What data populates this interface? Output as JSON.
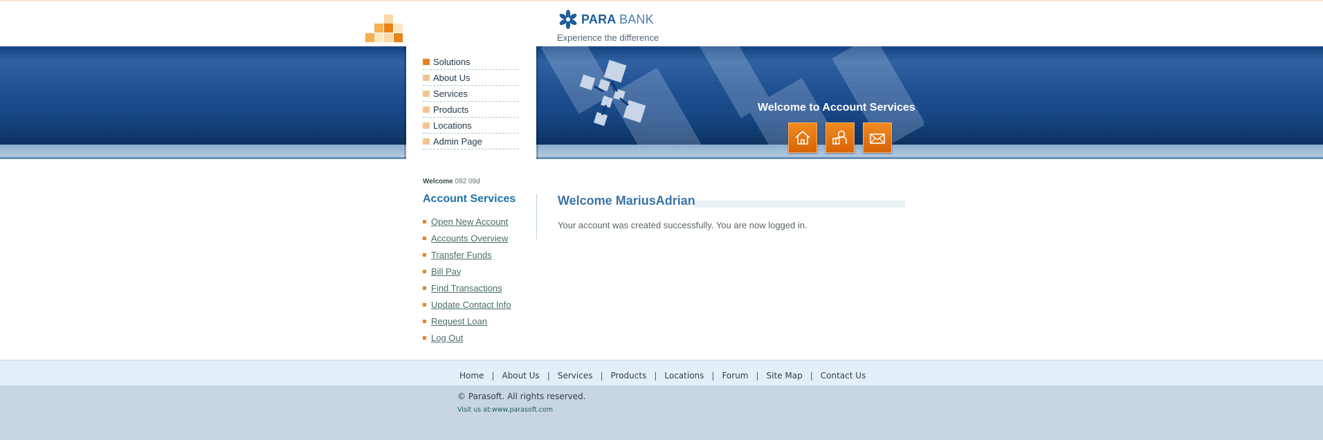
{
  "brand": {
    "name_bold": "PARA",
    "name_light": "BANK",
    "tagline": "Experience the difference"
  },
  "topnav": {
    "items": [
      "Solutions",
      "About Us",
      "Services",
      "Products",
      "Locations",
      "Admin Page"
    ]
  },
  "banner": {
    "welcome": "Welcome to Account Services",
    "icons": [
      "home-icon",
      "contact-icon",
      "mail-icon"
    ]
  },
  "sidebar": {
    "welcome_label": "Welcome",
    "welcome_user": "092 09d",
    "title": "Account Services",
    "links": [
      "Open New Account",
      "Accounts Overview",
      "Transfer Funds",
      "Bill Pay",
      "Find Transactions",
      "Update Contact Info",
      "Request Loan",
      "Log Out"
    ]
  },
  "main": {
    "title": "Welcome MariusAdrian",
    "message": "Your account was created successfully. You are now logged in."
  },
  "footer": {
    "links": [
      "Home",
      "About Us",
      "Services",
      "Products",
      "Locations",
      "Forum",
      "Site Map",
      "Contact Us"
    ],
    "separator": "|",
    "copyright": "© Parasoft. All rights reserved.",
    "visit_label": "Visit us at:",
    "visit_link": "www.parasoft.com"
  },
  "colors": {
    "accent_orange": "#e8831a",
    "brand_blue": "#1f5c99",
    "link_teal": "#4b6a6a"
  }
}
